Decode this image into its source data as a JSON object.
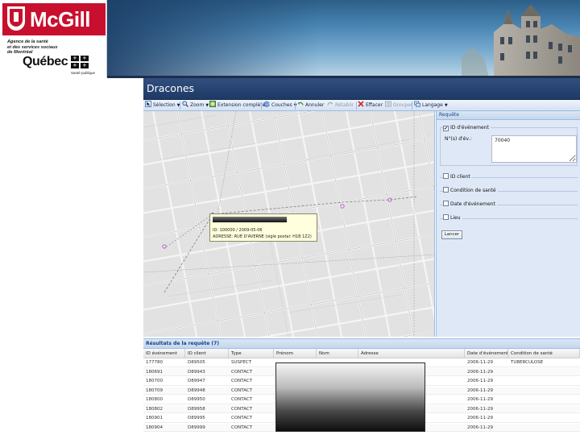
{
  "header": {
    "mcgill_logo": "McGill",
    "agency_lines": [
      "Agence de la santé",
      "et des services sociaux",
      "de Montréal"
    ],
    "quebec_logo": "Québec",
    "sante_publique": "Santé publique"
  },
  "app": {
    "title": "Dracones"
  },
  "toolbar": {
    "items": [
      {
        "label": "Sélection",
        "icon": "cursor-icon",
        "has_menu": true,
        "disabled": false
      },
      {
        "label": "Zoom",
        "icon": "magnifier-icon",
        "has_menu": true,
        "disabled": false
      },
      {
        "label": "Extension complète",
        "icon": "full-extent-icon",
        "has_menu": false,
        "disabled": false
      },
      {
        "label": "Couches",
        "icon": "layers-icon",
        "has_menu": true,
        "disabled": false
      },
      {
        "label": "Annuler",
        "icon": "undo-icon",
        "has_menu": false,
        "disabled": false
      },
      {
        "label": "Rétablir",
        "icon": "redo-icon",
        "has_menu": false,
        "disabled": true
      },
      {
        "label": "Effacer",
        "icon": "erase-icon",
        "has_menu": false,
        "disabled": false
      },
      {
        "label": "Grouper",
        "icon": "group-icon",
        "has_menu": false,
        "disabled": true
      },
      {
        "label": "Langage",
        "icon": "language-icon",
        "has_menu": true,
        "disabled": false
      }
    ]
  },
  "request_panel": {
    "title": "Requête",
    "event_id_label": "ID d'événement",
    "event_id_checked": true,
    "number_label": "N°(s) d'év.:",
    "number_value": "70040",
    "options": [
      {
        "label": "ID client",
        "checked": false
      },
      {
        "label": "Condition de santé",
        "checked": false
      },
      {
        "label": "Date d'événement",
        "checked": false
      },
      {
        "label": "Lieu",
        "checked": false
      }
    ],
    "submit_label": "Lancer"
  },
  "popup": {
    "line1": "ID: 100000 / 2009-05-06",
    "line2": "ADRESSE: RUE D'AVERNE (sigle postal: H1B 1Z2)"
  },
  "results": {
    "title": "Résultats de la requête (7)",
    "columns": [
      "ID événement",
      "ID client",
      "Type",
      "Prénom",
      "Nom",
      "Adresse",
      "Date d'événement",
      "Condition de santé"
    ],
    "rows": [
      [
        "177780",
        "D89505",
        "SUSPECT",
        "",
        "",
        "",
        "2006-11-29",
        "TUBERCULOSE"
      ],
      [
        "180691",
        "D89943",
        "CONTACT",
        "",
        "",
        "",
        "2006-11-29",
        ""
      ],
      [
        "180700",
        "D89947",
        "CONTACT",
        "",
        "",
        "",
        "2006-11-29",
        ""
      ],
      [
        "180709",
        "D89948",
        "CONTACT",
        "",
        "",
        "",
        "2006-11-29",
        ""
      ],
      [
        "180800",
        "D89950",
        "CONTACT",
        "",
        "",
        "",
        "2006-11-29",
        ""
      ],
      [
        "180802",
        "D89958",
        "CONTACT",
        "",
        "",
        "",
        "2006-11-29",
        ""
      ],
      [
        "180901",
        "D89995",
        "CONTACT",
        "",
        "",
        "",
        "2006-11-29",
        ""
      ],
      [
        "180904",
        "D89999",
        "CONTACT",
        "",
        "",
        "",
        "2006-11-29",
        ""
      ]
    ]
  },
  "colors": {
    "title_bar": "#1e3a66",
    "panel_bg": "#dfe8f6",
    "mcgill_red": "#c8102e",
    "map_bg": "#e2e2e2",
    "route_point": "#c058d0"
  }
}
